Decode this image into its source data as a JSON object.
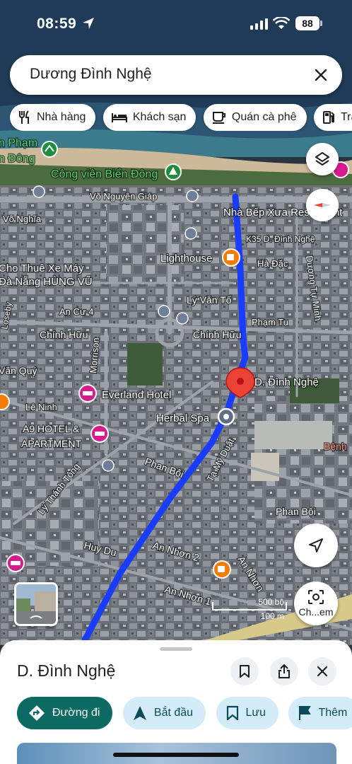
{
  "status_bar": {
    "time": "08:59",
    "battery": "88"
  },
  "search": {
    "query": "Dương Đình Nghệ"
  },
  "categories": [
    {
      "label": "Nhà hàng",
      "icon": "restaurant-icon"
    },
    {
      "label": "Khách sạn",
      "icon": "hotel-icon"
    },
    {
      "label": "Quán cà phê",
      "icon": "coffee-icon"
    },
    {
      "label": "Trạ",
      "icon": "gas-station-icon"
    }
  ],
  "map": {
    "street_labels": {
      "vo_nguyen_giap": "Võ Nguyên Giáp",
      "vo_nghia": "Võ Nghĩa",
      "an_cu_4": "An Cư 4",
      "chinh_huu_left": "Chính Hữu",
      "chinh_huu_right": "Chính Hữu",
      "morrison": "Morrison",
      "van_quy": "Văn Quý",
      "le_ninh": "Lê Ninh",
      "ly_thanh_tong": "Lý Thánh Tông",
      "phan_boi_left": "Phan Bội",
      "phan_boi_right": "Phan Bội",
      "huy_du": "Huy Du",
      "an_nhon_2": "An Nhơn 2",
      "an_nhon_1": "An Nhơn 1",
      "an_nhon": "An Nhơn",
      "ta_my_duat": "Tạ Mỹ Duật",
      "ly_van_to": "Lý Văn Tố",
      "pham_tu": "Phạm Tu",
      "ha_dac": "Hà Đặc",
      "duong_tu_minh": "Dương Tự Minh",
      "loseby": "Loseby",
      "k35": "K35 D. Đình Nghệ",
      "pham": "n Phạm",
      "dong": "n Đông",
      "benh": "Bệnh"
    },
    "places": {
      "cong_vien": "Công viên Biển Đông",
      "nha_bep": "Nhà Bếp Xưa Restaurant",
      "lighthouse": "Lighthouse",
      "cho_thue_1": "Cho Thuê Xe Máy",
      "cho_thue_2": "Đà Nẵng HÙNG VŨ",
      "everland": "Everland Hotel",
      "a9_1": "A9 HOTEL &",
      "a9_2": "APARTMENT",
      "herbal": "Herbal Spa",
      "pin_label": "D. Đình Nghệ"
    },
    "scale": {
      "imperial": "500 bộ",
      "metric": "100 m"
    },
    "lens_label": "Ch...em"
  },
  "place_sheet": {
    "title": "D. Đình Nghệ",
    "actions": [
      {
        "label": "Đường đi",
        "icon": "directions-icon"
      },
      {
        "label": "Bắt đầu",
        "icon": "navigation-arrow-icon"
      },
      {
        "label": "Lưu",
        "icon": "bookmark-icon"
      },
      {
        "label": "Thêm",
        "icon": "flag-icon"
      }
    ]
  },
  "colors": {
    "route": "#1a3cff",
    "pin": "#ea4335",
    "primary_action": "#0b6b63",
    "secondary_action": "#d3ecf7"
  }
}
